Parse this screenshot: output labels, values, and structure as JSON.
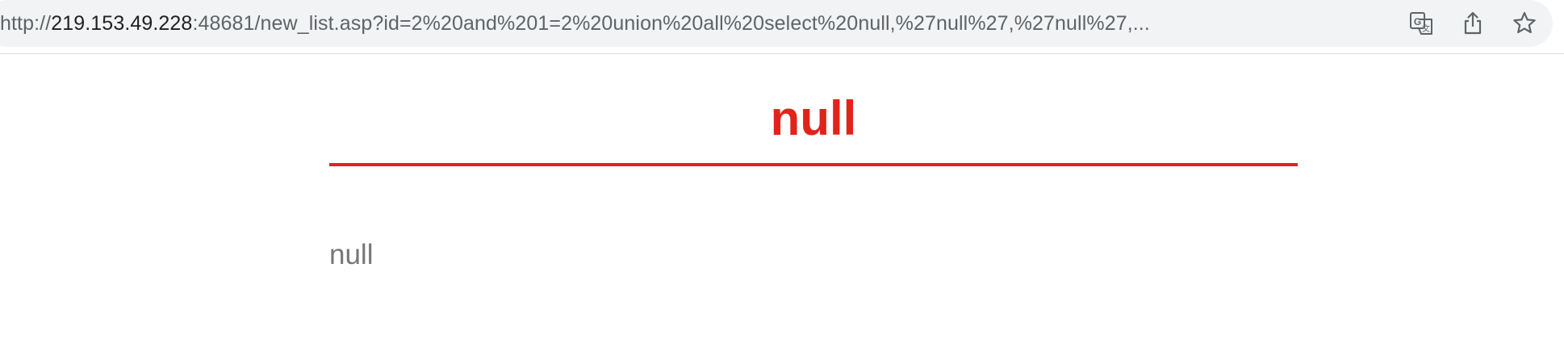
{
  "browser": {
    "url_scheme": "http://",
    "url_host": "219.153.49.228",
    "url_rest": ":48681/new_list.asp?id=2%20and%201=2%20union%20all%20select%20null,%27null%27,%27null%27,...",
    "icons": [
      "translate-icon",
      "share-icon",
      "star-icon"
    ]
  },
  "page": {
    "title": "null",
    "content": "null"
  },
  "colors": {
    "accent": "#e2231a",
    "body_text": "#777777"
  }
}
